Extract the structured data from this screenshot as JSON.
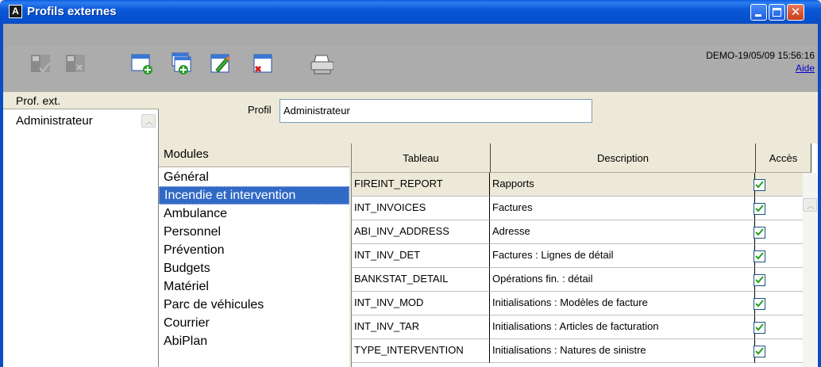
{
  "window": {
    "title": "Profils externes",
    "app_icon_letter": "A"
  },
  "toolbar": {
    "icons": [
      "save-icon",
      "cancel-save-icon",
      "new-icon",
      "copy-new-icon",
      "edit-icon",
      "delete-icon",
      "print-icon"
    ],
    "status": "DEMO-19/05/09 15:56:16",
    "help_label": "Aide"
  },
  "left_panel": {
    "header": "Prof. ext.",
    "items": [
      "Administrateur"
    ]
  },
  "profile": {
    "label": "Profil",
    "value": "Administrateur"
  },
  "modules": {
    "header": "Modules",
    "items": [
      "Général",
      "Incendie et intervention",
      "Ambulance",
      "Personnel",
      "Prévention",
      "Budgets",
      "Matériel",
      "Parc de véhicules",
      "Courrier",
      "AbiPlan"
    ],
    "selected": "Incendie et intervention"
  },
  "table": {
    "columns": [
      "Tableau",
      "Description",
      "Accès"
    ],
    "rows": [
      {
        "tableau": "FIREINT_REPORT",
        "description": "Rapports",
        "acces": true
      },
      {
        "tableau": "INT_INVOICES",
        "description": "Factures",
        "acces": true
      },
      {
        "tableau": "ABI_INV_ADDRESS",
        "description": "Adresse",
        "acces": true
      },
      {
        "tableau": "INT_INV_DET",
        "description": "Factures : Lignes de détail",
        "acces": true
      },
      {
        "tableau": "BANKSTAT_DETAIL",
        "description": "Opérations fin. : détail",
        "acces": true
      },
      {
        "tableau": "INT_INV_MOD",
        "description": "Initialisations : Modèles de facture",
        "acces": true
      },
      {
        "tableau": "INT_INV_TAR",
        "description": "Initialisations : Articles de facturation",
        "acces": true
      },
      {
        "tableau": "TYPE_INTERVENTION",
        "description": "Initialisations : Natures de sinistre",
        "acces": true
      }
    ]
  },
  "colors": {
    "titlebar": "#0a58d8",
    "selection": "#316ac5",
    "toolbar": "#a9a9a9"
  }
}
